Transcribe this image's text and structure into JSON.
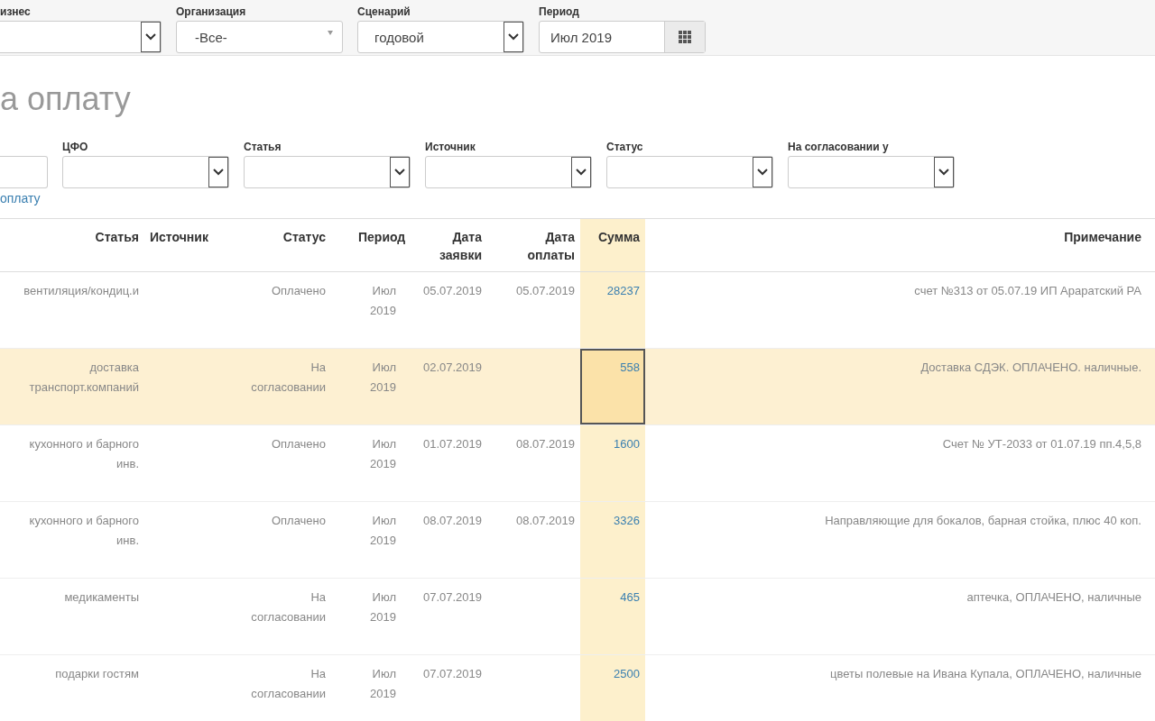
{
  "top_filters": [
    {
      "label": "изнес",
      "kind": "select"
    },
    {
      "label": "Организация",
      "kind": "dropdown",
      "value": "-Все-"
    },
    {
      "label": "Сценарий",
      "kind": "select",
      "value": "годовой"
    },
    {
      "label": "Период",
      "kind": "date",
      "value": "Июл 2019"
    }
  ],
  "page_title": "а оплату",
  "filters": [
    {
      "kind": "text"
    },
    {
      "label": "ЦФО",
      "kind": "select"
    },
    {
      "label": "Статья",
      "kind": "select"
    },
    {
      "label": "Источник",
      "kind": "select"
    },
    {
      "label": "Статус",
      "kind": "select"
    },
    {
      "label": "На согласовании у",
      "kind": "select"
    }
  ],
  "create_link": "оплату",
  "table": {
    "columns": [
      "Статья",
      "Источник",
      "Статус",
      "Период",
      "Дата заявки",
      "Дата оплаты",
      "Сумма",
      "Примечание"
    ],
    "rows": [
      {
        "selected": false,
        "cells": [
          "вентиляция/кондиц.и",
          null,
          "Оплачено",
          "Июл 2019",
          "05.07.2019",
          "05.07.2019",
          "28237",
          "счет №313 от 05.07.19 ИП Араратский РА"
        ]
      },
      {
        "selected": true,
        "cells": [
          "доставка транспорт.компаний",
          null,
          "На согласовании",
          "Июл 2019",
          "02.07.2019",
          null,
          "558",
          "Доставка СДЭК. ОПЛАЧЕНО. наличные."
        ]
      },
      {
        "selected": false,
        "cells": [
          "кухонного и барного инв.",
          null,
          "Оплачено",
          "Июл 2019",
          "01.07.2019",
          "08.07.2019",
          "1600",
          "Счет № УТ-2033 от 01.07.19 пп.4,5,8"
        ]
      },
      {
        "selected": false,
        "cells": [
          "кухонного и барного инв.",
          null,
          "Оплачено",
          "Июл 2019",
          "08.07.2019",
          "08.07.2019",
          "3326",
          "Направляющие для бокалов, барная стойка, плюс 40 коп."
        ]
      },
      {
        "selected": false,
        "cells": [
          "медикаменты",
          null,
          "На согласовании",
          "Июл 2019",
          "07.07.2019",
          null,
          "465",
          "аптечка, ОПЛАЧЕНО, наличные"
        ]
      },
      {
        "selected": false,
        "cells": [
          "подарки гостям",
          null,
          "На согласовании",
          "Июл 2019",
          "07.07.2019",
          null,
          "2500",
          "цветы полевые на Ивана Купала, ОПЛАЧЕНО, наличные"
        ]
      }
    ]
  }
}
